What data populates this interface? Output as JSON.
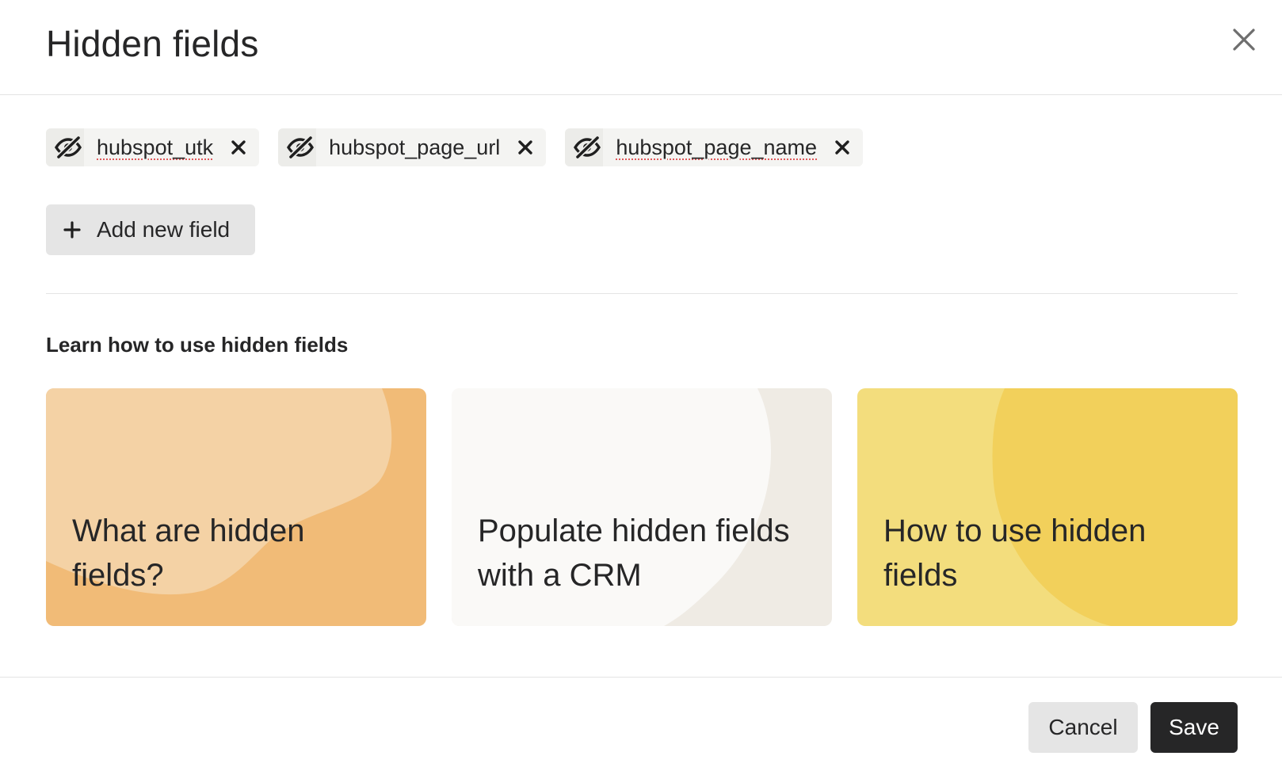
{
  "dialog": {
    "title": "Hidden fields",
    "close_icon": "close-icon"
  },
  "hidden_fields": [
    {
      "name": "hubspot_utk",
      "icon": "eye-off-icon",
      "spellcheck_flag": true
    },
    {
      "name": "hubspot_page_url",
      "icon": "eye-off-icon",
      "spellcheck_flag": false
    },
    {
      "name": "hubspot_page_name",
      "icon": "eye-off-icon",
      "spellcheck_flag": true
    }
  ],
  "add_field": {
    "label": "Add new field",
    "icon": "plus-icon"
  },
  "learn": {
    "heading": "Learn how to use hidden fields",
    "cards": [
      {
        "title": "What are hidden fields?",
        "color": "#f1bb77",
        "accent": "#f4d2a5"
      },
      {
        "title": "Populate hidden fields with a CRM",
        "color": "#efebe4",
        "accent": "#faf9f7"
      },
      {
        "title": "How to use hidden fields",
        "color": "#f3dd7d",
        "accent": "#f2d05b"
      }
    ]
  },
  "footer": {
    "cancel_label": "Cancel",
    "save_label": "Save"
  },
  "colors": {
    "text": "#262627",
    "primary_button": "#262627",
    "secondary_button": "#e5e5e5",
    "spellcheck_underline": "#e0585b"
  }
}
